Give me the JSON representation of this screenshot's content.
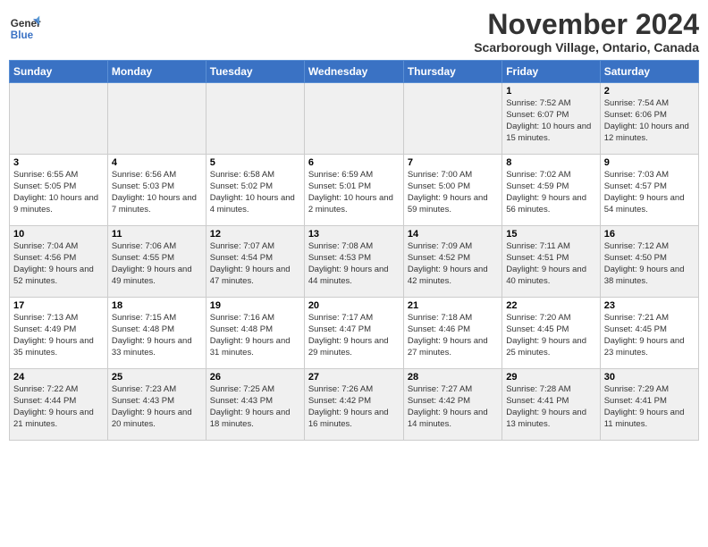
{
  "logo": {
    "line1": "General",
    "line2": "Blue"
  },
  "title": "November 2024",
  "subtitle": "Scarborough Village, Ontario, Canada",
  "days_of_week": [
    "Sunday",
    "Monday",
    "Tuesday",
    "Wednesday",
    "Thursday",
    "Friday",
    "Saturday"
  ],
  "weeks": [
    [
      {
        "day": "",
        "info": ""
      },
      {
        "day": "",
        "info": ""
      },
      {
        "day": "",
        "info": ""
      },
      {
        "day": "",
        "info": ""
      },
      {
        "day": "",
        "info": ""
      },
      {
        "day": "1",
        "info": "Sunrise: 7:52 AM\nSunset: 6:07 PM\nDaylight: 10 hours and 15 minutes."
      },
      {
        "day": "2",
        "info": "Sunrise: 7:54 AM\nSunset: 6:06 PM\nDaylight: 10 hours and 12 minutes."
      }
    ],
    [
      {
        "day": "3",
        "info": "Sunrise: 6:55 AM\nSunset: 5:05 PM\nDaylight: 10 hours and 9 minutes."
      },
      {
        "day": "4",
        "info": "Sunrise: 6:56 AM\nSunset: 5:03 PM\nDaylight: 10 hours and 7 minutes."
      },
      {
        "day": "5",
        "info": "Sunrise: 6:58 AM\nSunset: 5:02 PM\nDaylight: 10 hours and 4 minutes."
      },
      {
        "day": "6",
        "info": "Sunrise: 6:59 AM\nSunset: 5:01 PM\nDaylight: 10 hours and 2 minutes."
      },
      {
        "day": "7",
        "info": "Sunrise: 7:00 AM\nSunset: 5:00 PM\nDaylight: 9 hours and 59 minutes."
      },
      {
        "day": "8",
        "info": "Sunrise: 7:02 AM\nSunset: 4:59 PM\nDaylight: 9 hours and 56 minutes."
      },
      {
        "day": "9",
        "info": "Sunrise: 7:03 AM\nSunset: 4:57 PM\nDaylight: 9 hours and 54 minutes."
      }
    ],
    [
      {
        "day": "10",
        "info": "Sunrise: 7:04 AM\nSunset: 4:56 PM\nDaylight: 9 hours and 52 minutes."
      },
      {
        "day": "11",
        "info": "Sunrise: 7:06 AM\nSunset: 4:55 PM\nDaylight: 9 hours and 49 minutes."
      },
      {
        "day": "12",
        "info": "Sunrise: 7:07 AM\nSunset: 4:54 PM\nDaylight: 9 hours and 47 minutes."
      },
      {
        "day": "13",
        "info": "Sunrise: 7:08 AM\nSunset: 4:53 PM\nDaylight: 9 hours and 44 minutes."
      },
      {
        "day": "14",
        "info": "Sunrise: 7:09 AM\nSunset: 4:52 PM\nDaylight: 9 hours and 42 minutes."
      },
      {
        "day": "15",
        "info": "Sunrise: 7:11 AM\nSunset: 4:51 PM\nDaylight: 9 hours and 40 minutes."
      },
      {
        "day": "16",
        "info": "Sunrise: 7:12 AM\nSunset: 4:50 PM\nDaylight: 9 hours and 38 minutes."
      }
    ],
    [
      {
        "day": "17",
        "info": "Sunrise: 7:13 AM\nSunset: 4:49 PM\nDaylight: 9 hours and 35 minutes."
      },
      {
        "day": "18",
        "info": "Sunrise: 7:15 AM\nSunset: 4:48 PM\nDaylight: 9 hours and 33 minutes."
      },
      {
        "day": "19",
        "info": "Sunrise: 7:16 AM\nSunset: 4:48 PM\nDaylight: 9 hours and 31 minutes."
      },
      {
        "day": "20",
        "info": "Sunrise: 7:17 AM\nSunset: 4:47 PM\nDaylight: 9 hours and 29 minutes."
      },
      {
        "day": "21",
        "info": "Sunrise: 7:18 AM\nSunset: 4:46 PM\nDaylight: 9 hours and 27 minutes."
      },
      {
        "day": "22",
        "info": "Sunrise: 7:20 AM\nSunset: 4:45 PM\nDaylight: 9 hours and 25 minutes."
      },
      {
        "day": "23",
        "info": "Sunrise: 7:21 AM\nSunset: 4:45 PM\nDaylight: 9 hours and 23 minutes."
      }
    ],
    [
      {
        "day": "24",
        "info": "Sunrise: 7:22 AM\nSunset: 4:44 PM\nDaylight: 9 hours and 21 minutes."
      },
      {
        "day": "25",
        "info": "Sunrise: 7:23 AM\nSunset: 4:43 PM\nDaylight: 9 hours and 20 minutes."
      },
      {
        "day": "26",
        "info": "Sunrise: 7:25 AM\nSunset: 4:43 PM\nDaylight: 9 hours and 18 minutes."
      },
      {
        "day": "27",
        "info": "Sunrise: 7:26 AM\nSunset: 4:42 PM\nDaylight: 9 hours and 16 minutes."
      },
      {
        "day": "28",
        "info": "Sunrise: 7:27 AM\nSunset: 4:42 PM\nDaylight: 9 hours and 14 minutes."
      },
      {
        "day": "29",
        "info": "Sunrise: 7:28 AM\nSunset: 4:41 PM\nDaylight: 9 hours and 13 minutes."
      },
      {
        "day": "30",
        "info": "Sunrise: 7:29 AM\nSunset: 4:41 PM\nDaylight: 9 hours and 11 minutes."
      }
    ]
  ]
}
